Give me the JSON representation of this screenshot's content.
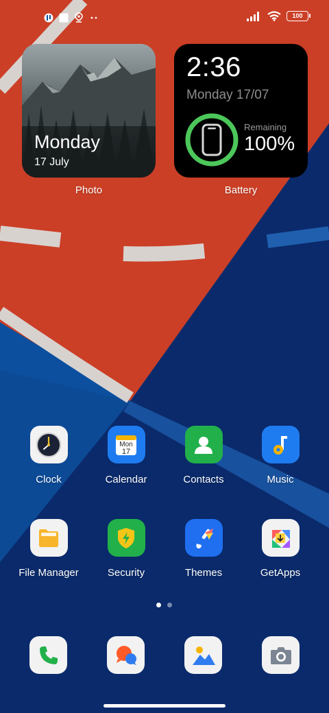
{
  "status_bar": {
    "battery_level": "100",
    "notification_icons": [
      "app-notification-icon",
      "square-notification-icon",
      "location-notification-icon",
      "more-notifications-icon"
    ],
    "right_icons": [
      "signal-icon",
      "wifi-icon",
      "battery-icon"
    ]
  },
  "widgets": {
    "photo": {
      "day": "Monday",
      "date": "17 July",
      "label": "Photo"
    },
    "battery": {
      "time": "2:36",
      "date": "Monday 17/07",
      "remaining_label": "Remaining",
      "percent": "100%",
      "level": 1.0,
      "ring_color": "#4cc75a",
      "label": "Battery"
    }
  },
  "apps": [
    {
      "label": "Clock",
      "icon": "clock-icon"
    },
    {
      "label": "Calendar",
      "icon": "calendar-icon",
      "icon_text_top": "Mon",
      "icon_text_bottom": "17"
    },
    {
      "label": "Contacts",
      "icon": "contacts-icon"
    },
    {
      "label": "Music",
      "icon": "music-icon"
    },
    {
      "label": "File Manager",
      "icon": "folder-icon"
    },
    {
      "label": "Security",
      "icon": "security-shield-icon"
    },
    {
      "label": "Themes",
      "icon": "themes-brush-icon"
    },
    {
      "label": "GetApps",
      "icon": "getapps-icon"
    }
  ],
  "page_indicator": {
    "pages": 2,
    "current": 1
  },
  "dock": [
    {
      "icon": "phone-icon"
    },
    {
      "icon": "messages-icon"
    },
    {
      "icon": "gallery-icon"
    },
    {
      "icon": "camera-icon"
    }
  ],
  "colors": {
    "wallpaper_red": "#cb3f26",
    "wallpaper_blue": "#0b4f9e",
    "wallpaper_navy": "#0a2a6b",
    "accent_green": "#4cc75a"
  }
}
